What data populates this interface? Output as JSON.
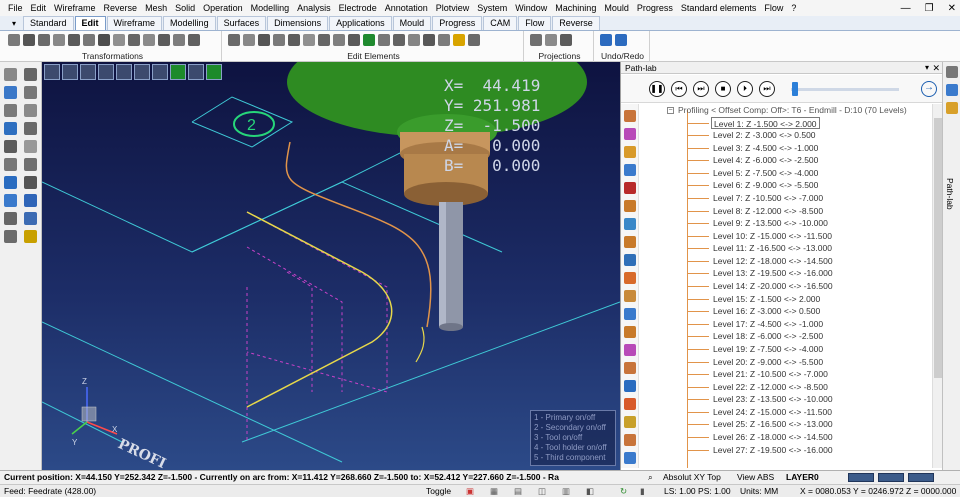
{
  "menu": [
    "File",
    "Edit",
    "Wireframe",
    "Reverse",
    "Mesh",
    "Solid",
    "Operation",
    "Modelling",
    "Analysis",
    "Electrode",
    "Annotation",
    "Plotview",
    "System",
    "Window",
    "Machining",
    "Mould",
    "Progress",
    "Standard elements",
    "Flow",
    "?"
  ],
  "tabs": [
    "Standard",
    "Edit",
    "Wireframe",
    "Modelling",
    "Surfaces",
    "Dimensions",
    "Applications",
    "Mould",
    "Progress",
    "CAM",
    "Flow",
    "Reverse"
  ],
  "active_tab": "Edit",
  "ribbon_groups": [
    "Transformations",
    "Edit Elements",
    "Projections",
    "Undo/Redo"
  ],
  "viewport": {
    "coords": {
      "x": "X=  44.419",
      "y": "Y= 251.981",
      "z": "Z=  -1.500",
      "a": "A=   0.000",
      "b": "B=   0.000"
    },
    "marker": "2",
    "legend": [
      "1 - Primary on/off",
      "2 - Secondary on/off",
      "3 - Tool on/off",
      "4 - Tool holder on/off",
      "5 - Third component"
    ],
    "watermark": "PROFI",
    "axis": {
      "z": "Z",
      "x": "X",
      "y": "Y"
    }
  },
  "pathlab": {
    "title": "Path-lab",
    "pin": "▾ ✕",
    "root": "Profiling < Offset Comp: Off>: T6 - Endmill - D:10 (70 Levels)",
    "levels": [
      "Level 1: Z -1.500 <-> 2.000",
      "Level 2: Z -3.000 <-> 0.500",
      "Level 3: Z -4.500 <-> -1.000",
      "Level 4: Z -6.000 <-> -2.500",
      "Level 5: Z -7.500 <-> -4.000",
      "Level 6: Z -9.000 <-> -5.500",
      "Level 7: Z -10.500 <-> -7.000",
      "Level 8: Z -12.000 <-> -8.500",
      "Level 9: Z -13.500 <-> -10.000",
      "Level 10: Z -15.000 <-> -11.500",
      "Level 11: Z -16.500 <-> -13.000",
      "Level 12: Z -18.000 <-> -14.500",
      "Level 13: Z -19.500 <-> -16.000",
      "Level 14: Z -20.000 <-> -16.500",
      "Level 15: Z -1.500 <-> 2.000",
      "Level 16: Z -3.000 <-> 0.500",
      "Level 17: Z -4.500 <-> -1.000",
      "Level 18: Z -6.000 <-> -2.500",
      "Level 19: Z -7.500 <-> -4.000",
      "Level 20: Z -9.000 <-> -5.500",
      "Level 21: Z -10.500 <-> -7.000",
      "Level 22: Z -12.000 <-> -8.500",
      "Level 23: Z -13.500 <-> -10.000",
      "Level 24: Z -15.000 <-> -11.500",
      "Level 25: Z -16.500 <-> -13.000",
      "Level 26: Z -18.000 <-> -14.500",
      "Level 27: Z -19.500 <-> -16.000"
    ],
    "side_label": "Path-lab"
  },
  "status": {
    "position": "Current position: X=44.150 Y=252.342 Z=-1.500 - Currently on arc from: X=11.412 Y=268.660 Z=-1.500 to: X=52.412 Y=227.660 Z=-1.500 - Ra",
    "view": "Absolut XY Top",
    "view_abs": "View ABS",
    "layer": "LAYER0",
    "feedrate": "Feed: Feedrate (428.00)",
    "toggle": "Toggle",
    "ls": "LS: 1.00 PS: 1.00",
    "units": "Units: MM",
    "coords": "X = 0080.053 Y = 0246.972 Z = 0000.000"
  },
  "colors": {
    "accent": "#2c7fd8",
    "toolpath": "#e1944a",
    "tool_green": "#2e8b22"
  }
}
